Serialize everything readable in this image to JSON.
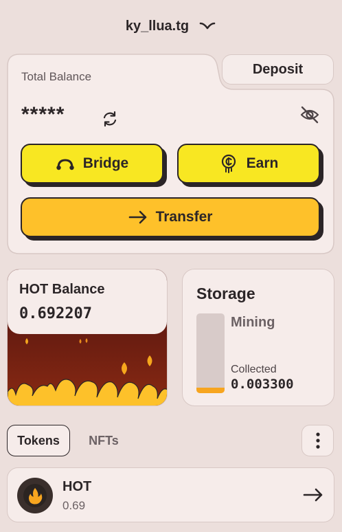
{
  "header": {
    "account_name": "ky_llua.tg"
  },
  "balance": {
    "label": "Total Balance",
    "masked_value": "*****",
    "deposit_label": "Deposit"
  },
  "actions": {
    "bridge_label": "Bridge",
    "earn_label": "Earn",
    "transfer_label": "Transfer"
  },
  "hot_card": {
    "title": "HOT Balance",
    "value": "0.692207"
  },
  "storage": {
    "title": "Storage",
    "status": "Mining",
    "collected_label": "Collected",
    "collected_value": "0.003300",
    "fill_fraction": 0.07
  },
  "tabs": [
    {
      "label": "Tokens",
      "active": true
    },
    {
      "label": "NFTs",
      "active": false
    }
  ],
  "tokens": [
    {
      "name": "HOT",
      "amount": "0.69"
    }
  ],
  "colors": {
    "background": "#ecdfdc",
    "card": "#f6ecea",
    "yellow": "#f8e722",
    "orange": "#fec12a",
    "ink": "#2b2527",
    "fire_dark": "#5b1414",
    "flame": "#fdc12a"
  },
  "icons": {
    "account_chevron": "chevron-down-icon",
    "refresh": "refresh-icon",
    "hide": "eye-off-icon",
    "bridge": "bridge-icon",
    "earn": "coin-icon",
    "transfer": "arrow-right-icon",
    "more": "more-vertical-icon",
    "token": "flame-icon",
    "row_action": "arrow-right-icon"
  }
}
